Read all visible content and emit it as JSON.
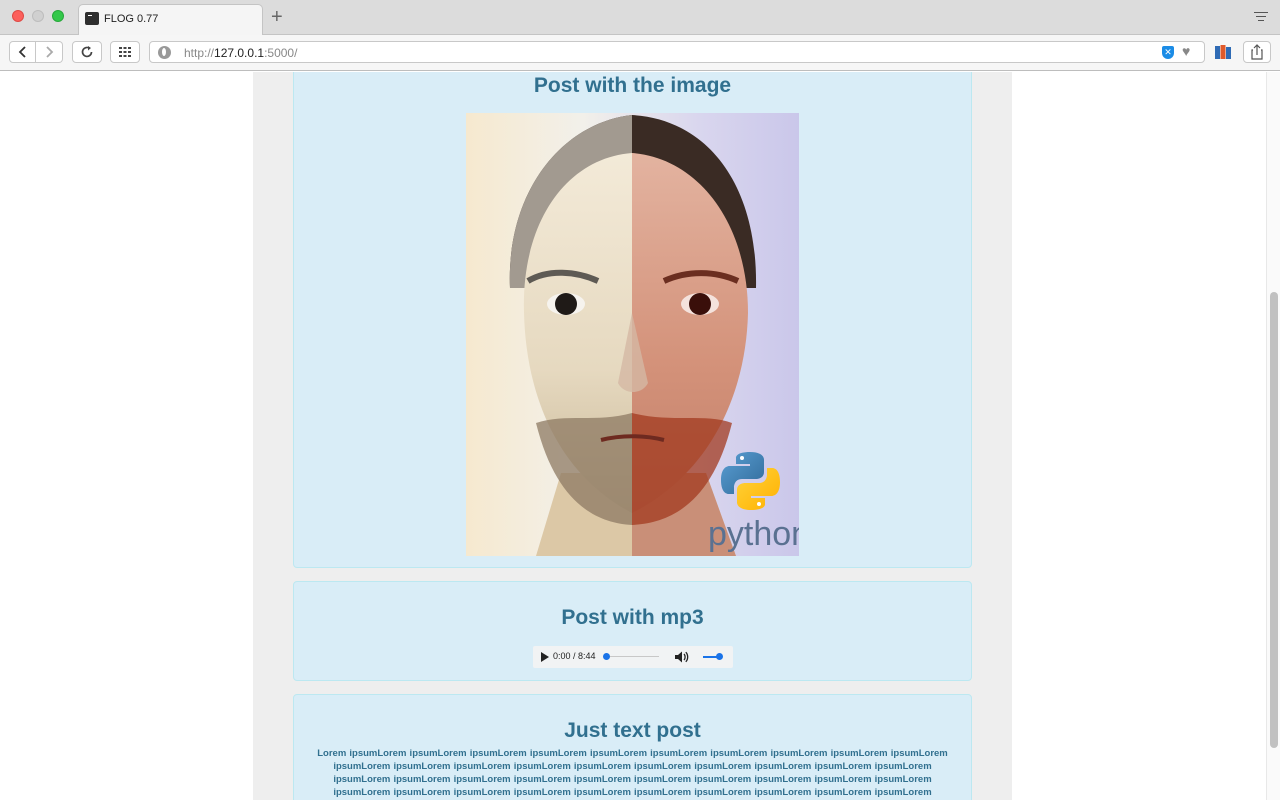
{
  "browser": {
    "tab_title": "FLOG 0.77",
    "url_scheme": "http://",
    "url_host": "127.0.0.1",
    "url_rest": ":5000/"
  },
  "posts": [
    {
      "title": "Post with the image",
      "image_watermark": "python"
    },
    {
      "title": "Post with mp3",
      "audio_time": "0:00 / 8:44"
    },
    {
      "title": "Just text post",
      "body": "Lorem ipsumLorem ipsumLorem ipsumLorem ipsumLorem ipsumLorem ipsumLorem ipsumLorem ipsumLorem ipsumLorem ipsumLorem ipsumLorem ipsumLorem ipsumLorem ipsumLorem ipsumLorem ipsumLorem ipsumLorem ipsumLorem ipsumLorem ipsumLorem ipsumLorem ipsumLorem ipsumLorem ipsumLorem ipsumLorem ipsumLorem ipsumLorem ipsumLorem ipsumLorem ipsumLorem ipsumLorem ipsumLorem ipsumLorem ipsumLorem ipsumLorem ipsumLorem ipsumLorem ipsumLorem ipsumLorem ipsumLorem ipsumLorem"
    }
  ],
  "colors": {
    "post_bg": "#d9edf7",
    "post_text": "#31708f",
    "column_bg": "#eeeeee"
  }
}
